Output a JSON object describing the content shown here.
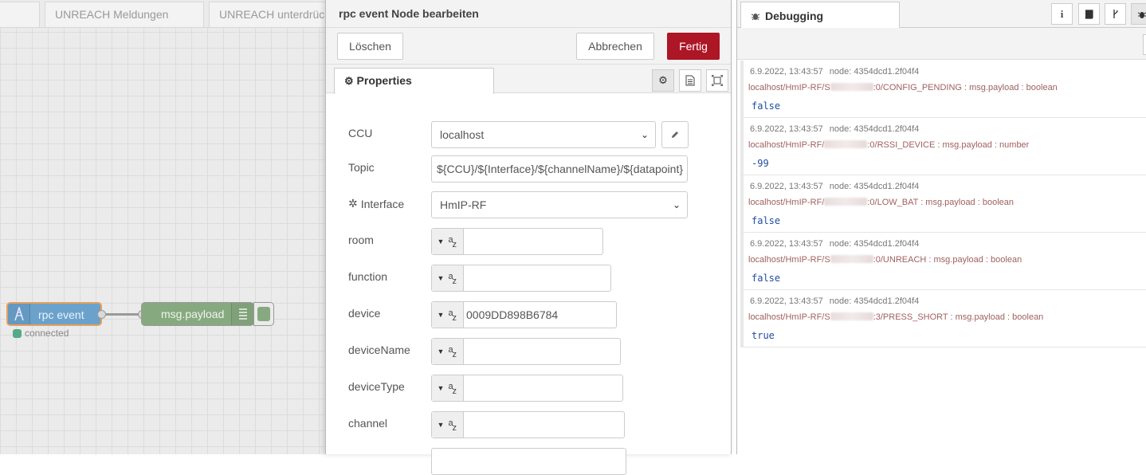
{
  "workspace": {
    "tabs": [
      "UNREACH Meldungen",
      "UNREACH unterdrücken"
    ],
    "node_rpc": {
      "label": "rpc event",
      "status": "connected"
    },
    "node_debug": {
      "label": "msg.payload"
    }
  },
  "editor": {
    "title": "rpc event Node bearbeiten",
    "buttons": {
      "delete": "Löschen",
      "cancel": "Abbrechen",
      "done": "Fertig"
    },
    "tab": "Properties",
    "fields": {
      "ccu": {
        "label": "CCU",
        "value": "localhost"
      },
      "topic": {
        "label": "Topic",
        "value": "${CCU}/${Interface}/${channelName}/${datapoint}"
      },
      "interface": {
        "label": "Interface",
        "value": "HmIP-RF"
      },
      "room": {
        "label": "room",
        "value": ""
      },
      "function": {
        "label": "function",
        "value": ""
      },
      "device": {
        "label": "device",
        "value": "0009DD898B6784"
      },
      "deviceName": {
        "label": "deviceName",
        "value": ""
      },
      "deviceType": {
        "label": "deviceType",
        "value": ""
      },
      "channel": {
        "label": "channel",
        "value": ""
      }
    }
  },
  "sidebar": {
    "tab": "Debugging",
    "messages": [
      {
        "time": "6.9.2022, 13:43:57",
        "node": "node: 4354dcd1.2f04f4",
        "topic_prefix": "localhost/HmIP-RF/S",
        "topic_suffix": ":0/CONFIG_PENDING : msg.payload : boolean",
        "value": "false"
      },
      {
        "time": "6.9.2022, 13:43:57",
        "node": "node: 4354dcd1.2f04f4",
        "topic_prefix": "localhost/HmIP-RF/",
        "topic_suffix": ":0/RSSI_DEVICE : msg.payload : number",
        "value": "-99"
      },
      {
        "time": "6.9.2022, 13:43:57",
        "node": "node: 4354dcd1.2f04f4",
        "topic_prefix": "localhost/HmIP-RF/",
        "topic_suffix": ":0/LOW_BAT : msg.payload : boolean",
        "value": "false"
      },
      {
        "time": "6.9.2022, 13:43:57",
        "node": "node: 4354dcd1.2f04f4",
        "topic_prefix": "localhost/HmIP-RF/S",
        "topic_suffix": ":0/UNREACH : msg.payload : boolean",
        "value": "false"
      },
      {
        "time": "6.9.2022, 13:43:57",
        "node": "node: 4354dcd1.2f04f4",
        "topic_prefix": "localhost/HmIP-RF/S",
        "topic_suffix": ":3/PRESS_SHORT : msg.payload : boolean",
        "value": "true"
      }
    ]
  },
  "icons": {
    "gear": "gear-icon",
    "info": "info-icon",
    "book": "book-icon",
    "bug": "bug-icon",
    "pencil": "pencil-icon"
  },
  "colors": {
    "done_button": "#ad1625",
    "rpc_node": "#6aa2cc",
    "debug_node": "#87a980",
    "selected_outline": "#e8a05c"
  }
}
